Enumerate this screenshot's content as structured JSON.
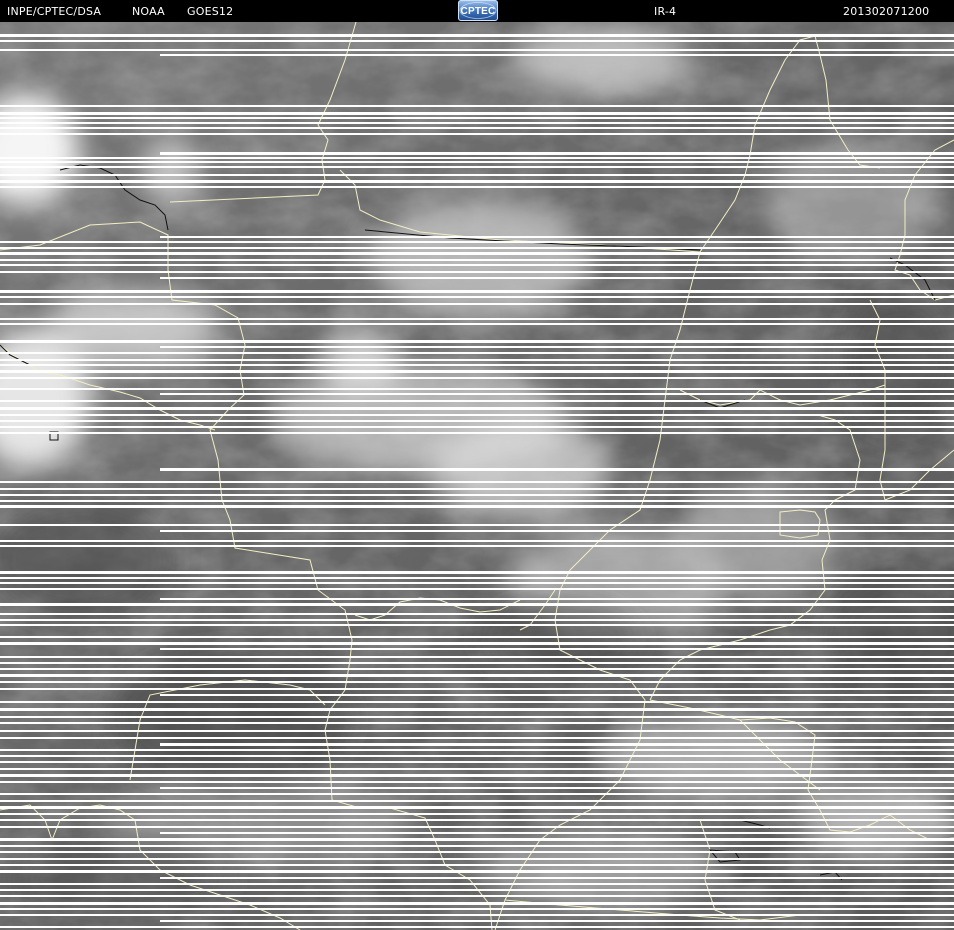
{
  "header": {
    "agency": "INPE/CPTEC/DSA",
    "operator": "NOAA",
    "satellite": "GOES12",
    "logo_text": "CPTEC",
    "channel": "IR-4",
    "datetime": "201302071200"
  },
  "colors": {
    "header_bg": "#000000",
    "header_text": "#ffffff",
    "border_lines": "#f4f0c8",
    "scan_gap_lines": "#ffffff"
  },
  "map": {
    "type": "satellite-infrared-image",
    "palette": "grayscale",
    "features": [
      "cloud-field",
      "political-borders",
      "state-borders",
      "coastline",
      "scan-line-gaps"
    ]
  }
}
